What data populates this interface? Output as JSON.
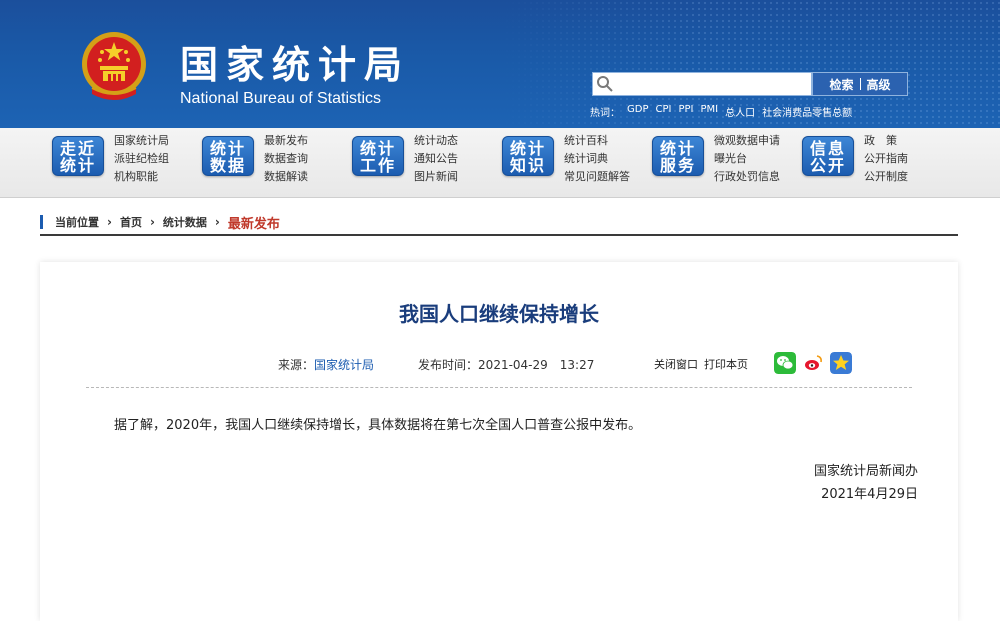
{
  "header": {
    "title": "国家统计局",
    "subtitle": "National Bureau of Statistics",
    "search": {
      "placeholder": "",
      "search_label": "检索",
      "advanced_label": "高级"
    },
    "hot_words": {
      "label": "热词：",
      "items": [
        "GDP",
        "CPI",
        "PPI",
        "PMI",
        "总人口",
        "社会消费品零售总额"
      ]
    }
  },
  "nav": {
    "groups": [
      {
        "badge": [
          "走近",
          "统计"
        ],
        "links": [
          "国家统计局",
          "派驻纪检组",
          "机构职能"
        ]
      },
      {
        "badge": [
          "统计",
          "数据"
        ],
        "links": [
          "最新发布",
          "数据查询",
          "数据解读"
        ]
      },
      {
        "badge": [
          "统计",
          "工作"
        ],
        "links": [
          "统计动态",
          "通知公告",
          "图片新闻"
        ]
      },
      {
        "badge": [
          "统计",
          "知识"
        ],
        "links": [
          "统计百科",
          "统计词典",
          "常见问题解答"
        ]
      },
      {
        "badge": [
          "统计",
          "服务"
        ],
        "links": [
          "微观数据申请",
          "曝光台",
          "行政处罚信息"
        ]
      },
      {
        "badge": [
          "信息",
          "公开"
        ],
        "links": [
          "政　策",
          "公开指南",
          "公开制度"
        ]
      }
    ]
  },
  "breadcrumb": {
    "label": "当前位置",
    "sep": "›",
    "items": [
      "首页",
      "统计数据"
    ],
    "current": "最新发布"
  },
  "article": {
    "title": "我国人口继续保持增长",
    "source_label": "来源：",
    "source_value": "国家统计局",
    "time_label": "发布时间：",
    "time_value": "2021-04-29　13:27",
    "close_window": "关闭窗口",
    "print_page": "打印本页",
    "share_icons": [
      "wechat-icon",
      "weibo-icon",
      "favorite-icon"
    ],
    "body": "据了解，2020年，我国人口继续保持增长，具体数据将在第七次全国人口普查公报中发布。",
    "signature_org": "国家统计局新闻办",
    "signature_date": "2021年4月29日"
  },
  "colors": {
    "header_blue": "#1b4f9c",
    "nav_badge_blue": "#1c5cb0",
    "title_blue": "#1a3d7c",
    "current_red": "#c0392b"
  }
}
